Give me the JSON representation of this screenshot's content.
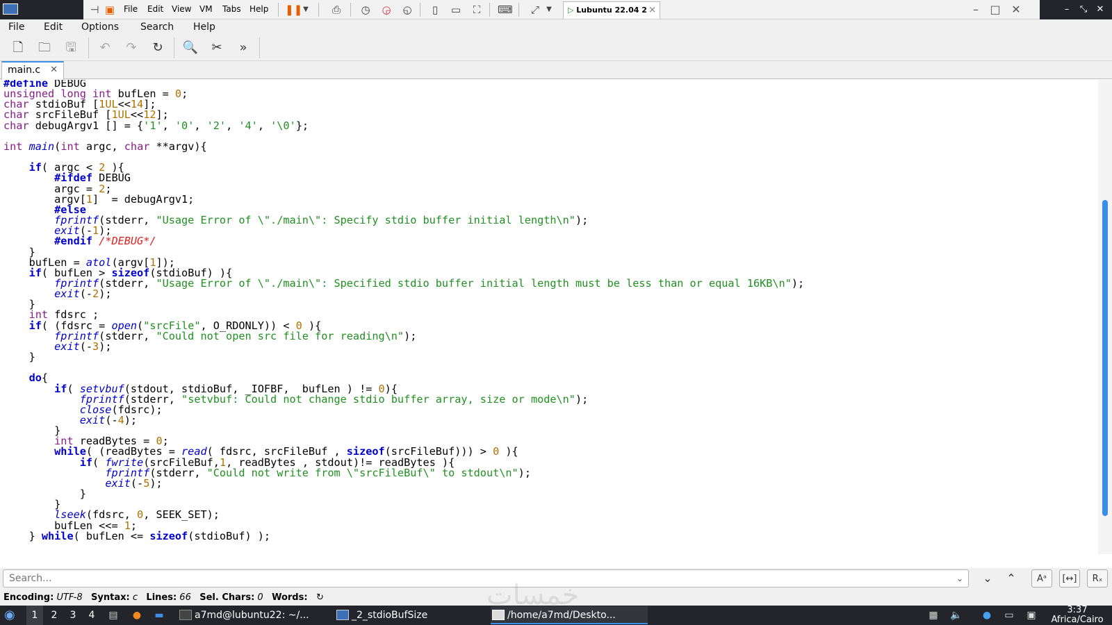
{
  "vm": {
    "menus": [
      "File",
      "Edit",
      "View",
      "VM",
      "Tabs",
      "Help"
    ],
    "tab_label": "Lubuntu 22.04 2"
  },
  "app": {
    "menus": [
      "File",
      "Edit",
      "Options",
      "Search",
      "Help"
    ]
  },
  "tabs": [
    {
      "label": "main.c"
    }
  ],
  "editor": {
    "language": "c"
  },
  "search": {
    "placeholder": "Search..."
  },
  "status": {
    "encoding_label": "Encoding:",
    "encoding": "UTF-8",
    "syntax_label": "Syntax:",
    "syntax": "c",
    "lines_label": "Lines:",
    "lines": "66",
    "selchars_label": "Sel. Chars:",
    "selchars": "0",
    "words_label": "Words:"
  },
  "taskbar": {
    "desktops": [
      "1",
      "2",
      "3",
      "4"
    ],
    "windows": [
      "a7md@lubuntu22: ~/...",
      "_2_stdioBufSize",
      "/home/a7md/Deskto..."
    ],
    "clock_time": "3:37",
    "clock_zone": "Africa/Cairo"
  },
  "watermark": "خمسات",
  "colors": {
    "keyword": "#0000cc",
    "type": "#8a1b8a",
    "string": "#209020",
    "number": "#b07000",
    "comment": "#e02020",
    "accent": "#3b8ee6",
    "taskbar": "#23252b"
  }
}
